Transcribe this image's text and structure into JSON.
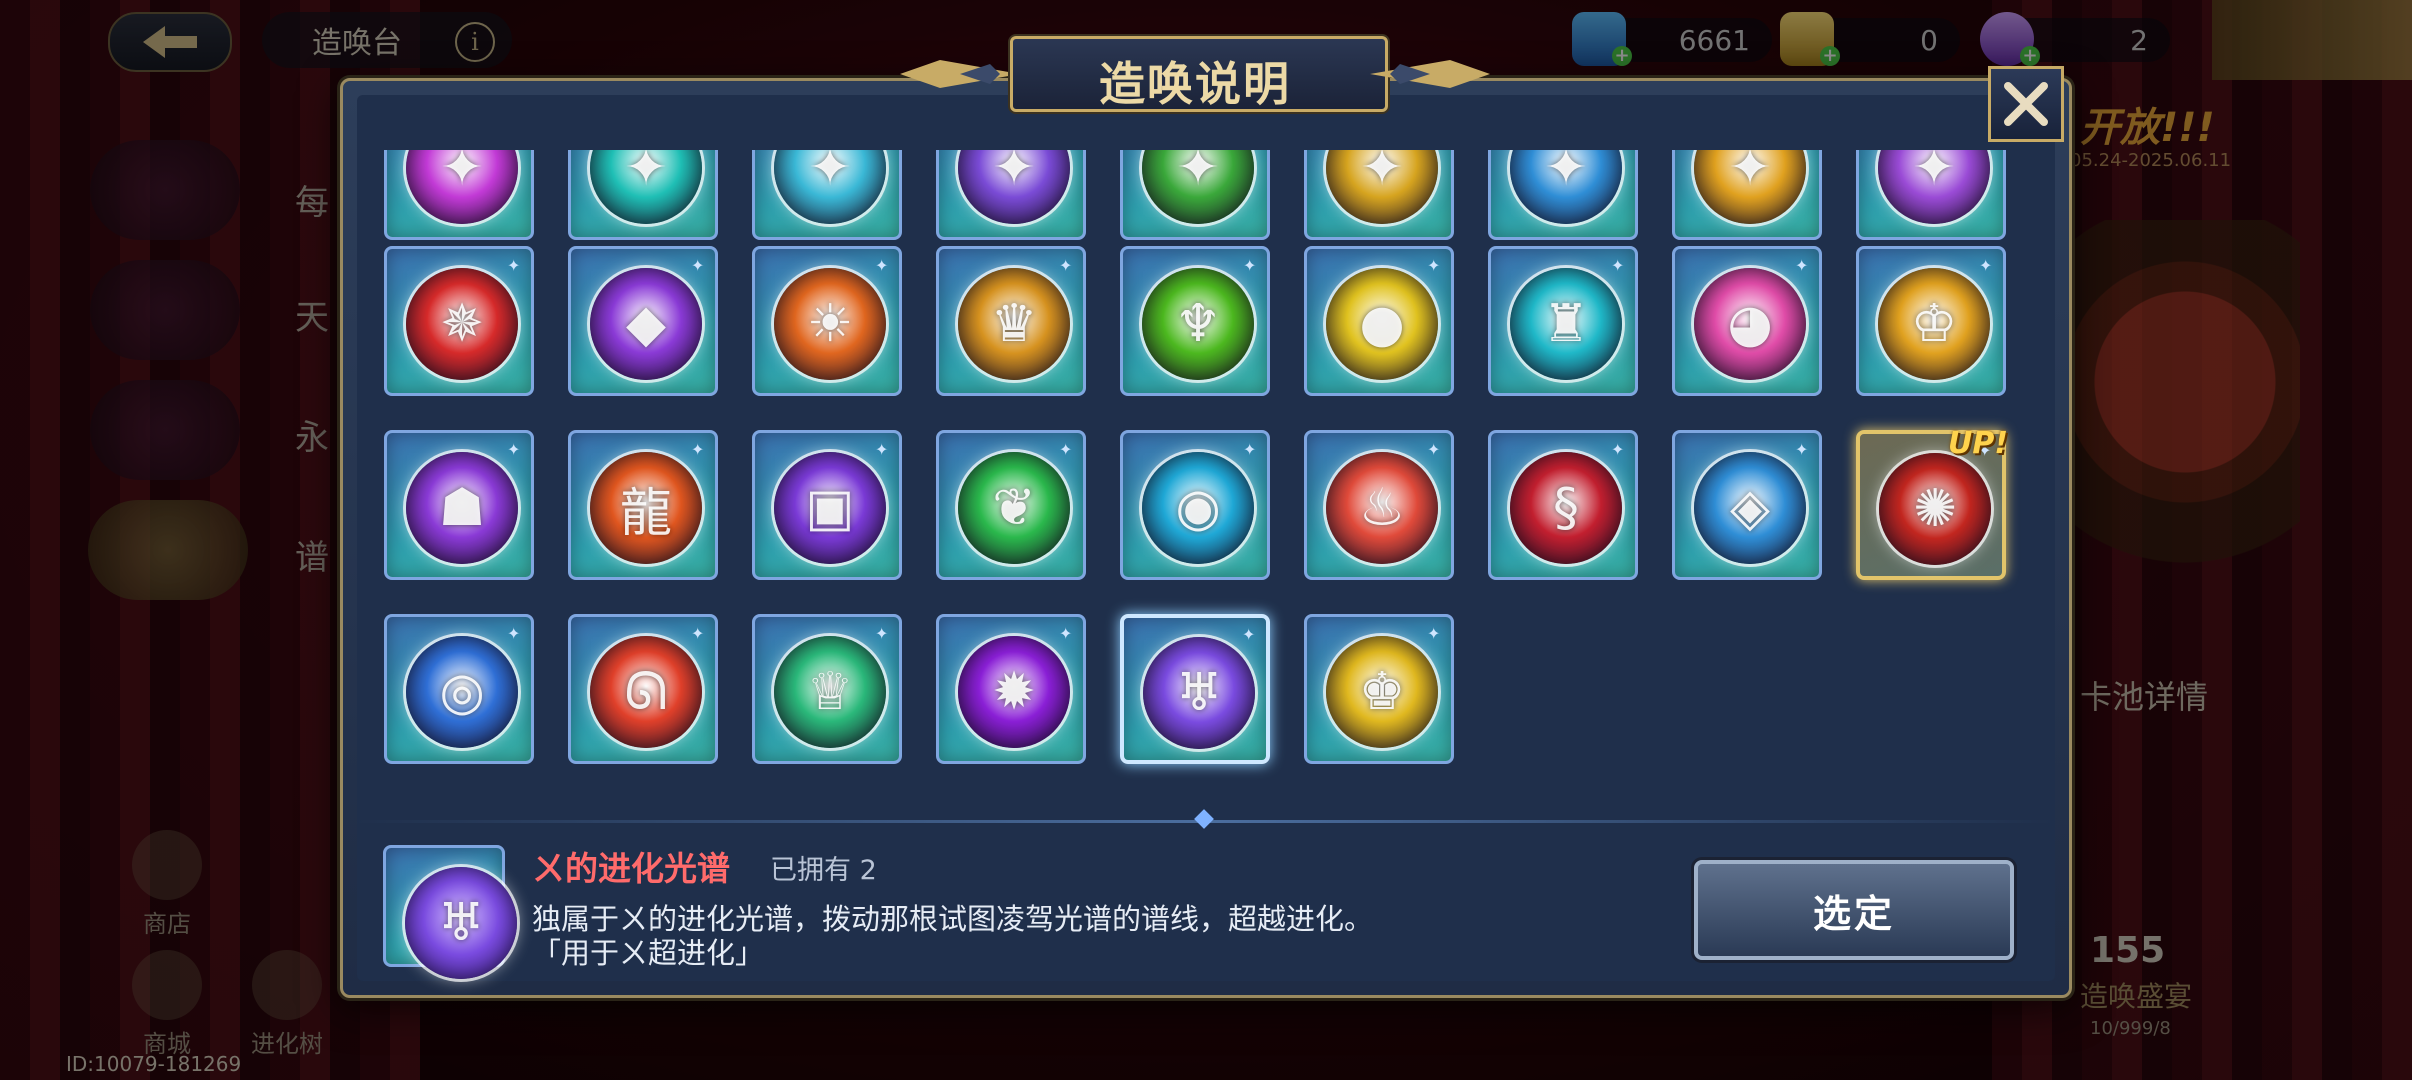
{
  "topbar": {
    "title": "造唤台",
    "currencies": [
      {
        "name": "gem",
        "value": "6661",
        "color": "#3aa0e0"
      },
      {
        "name": "ticket",
        "value": "0",
        "color": "#e0c23a"
      },
      {
        "name": "orb",
        "value": "2",
        "color": "#a070d0"
      }
    ],
    "top_right_label": "帮助"
  },
  "side_menu": [
    {
      "label": "每"
    },
    {
      "label": "天"
    },
    {
      "label": "永"
    },
    {
      "label": "谱"
    }
  ],
  "bottom_nav": [
    {
      "label": "商店"
    },
    {
      "label": "进化树"
    },
    {
      "label": "商城"
    }
  ],
  "player_id": "ID:10079-181269",
  "right_panel": {
    "banner": "开放!!!",
    "date": "05.24-2025.06.11",
    "pool_details": "卡池详情",
    "count": "155",
    "feast": "造唤盛宴",
    "sub": "10/999/8"
  },
  "modal": {
    "title": "造唤说明",
    "close_label": "✕",
    "select_button": "选定",
    "item_detail": {
      "name": "ㄨ的进化光谱",
      "owned": "已拥有 2",
      "description": "独属于ㄨ的进化光谱，拨动那根试图凌驾光谱的谱线，超越进化。",
      "usage": "「用于ㄨ超进化」"
    },
    "up_badge": "UP!"
  },
  "items": [
    {
      "row": 0,
      "glyph": "✦",
      "color": "#c23ad6"
    },
    {
      "row": 0,
      "glyph": "✦",
      "color": "#1fbfb5"
    },
    {
      "row": 0,
      "glyph": "✦",
      "color": "#3ab8d6"
    },
    {
      "row": 0,
      "glyph": "✦",
      "color": "#7a4bd6"
    },
    {
      "row": 0,
      "glyph": "✦",
      "color": "#3aa83a"
    },
    {
      "row": 0,
      "glyph": "✦",
      "color": "#d6a41f"
    },
    {
      "row": 0,
      "glyph": "✦",
      "color": "#2f8ed6"
    },
    {
      "row": 0,
      "glyph": "✦",
      "color": "#e0a11f"
    },
    {
      "row": 0,
      "glyph": "✦",
      "color": "#9a4bd6"
    },
    {
      "row": 1,
      "glyph": "✵",
      "color": "#d62a2a"
    },
    {
      "row": 1,
      "glyph": "◆",
      "color": "#8a3ad6"
    },
    {
      "row": 1,
      "glyph": "☀",
      "color": "#e0661f"
    },
    {
      "row": 1,
      "glyph": "♛",
      "color": "#d6921f"
    },
    {
      "row": 1,
      "glyph": "♆",
      "color": "#4cb81f"
    },
    {
      "row": 1,
      "glyph": "●",
      "color": "#e0c21f"
    },
    {
      "row": 1,
      "glyph": "♜",
      "color": "#1fb8c8"
    },
    {
      "row": 1,
      "glyph": "◕",
      "color": "#e04ca8"
    },
    {
      "row": 1,
      "glyph": "♔",
      "color": "#e0a11f"
    },
    {
      "row": 2,
      "glyph": "☗",
      "color": "#8a3ad6"
    },
    {
      "row": 2,
      "glyph": "龍",
      "color": "#e0561f"
    },
    {
      "row": 2,
      "glyph": "▣",
      "color": "#7a3ad6"
    },
    {
      "row": 2,
      "glyph": "❦",
      "color": "#2ab84c"
    },
    {
      "row": 2,
      "glyph": "◉",
      "color": "#1fa8d6"
    },
    {
      "row": 2,
      "glyph": "♨",
      "color": "#e04a3a"
    },
    {
      "row": 2,
      "glyph": "§",
      "color": "#c21f2f"
    },
    {
      "row": 2,
      "glyph": "◈",
      "color": "#2f8ed6"
    },
    {
      "row": 2,
      "glyph": "✺",
      "color": "#c2261f",
      "up": true
    },
    {
      "row": 3,
      "glyph": "◎",
      "color": "#2f6fd6"
    },
    {
      "row": 3,
      "glyph": "ᘏ",
      "color": "#e0402a"
    },
    {
      "row": 3,
      "glyph": "♕",
      "color": "#2ab87a"
    },
    {
      "row": 3,
      "glyph": "✹",
      "color": "#8a1fd6"
    },
    {
      "row": 3,
      "glyph": "♅",
      "color": "#7a4be0",
      "selected": true
    },
    {
      "row": 3,
      "glyph": "♚",
      "color": "#e0b81f"
    }
  ]
}
